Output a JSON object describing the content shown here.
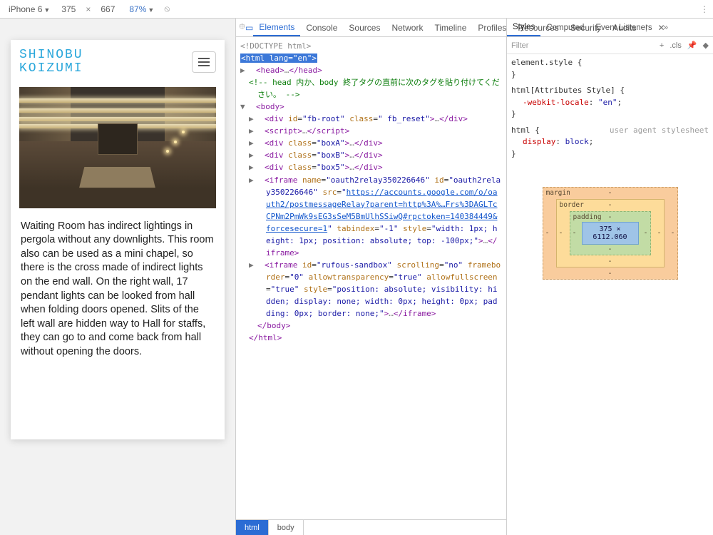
{
  "deviceToolbar": {
    "device": "iPhone 6",
    "width": "375",
    "height": "667",
    "zoom": "87%"
  },
  "mobile": {
    "logoLine1": "SHINOBU",
    "logoLine2": "KOIZUMI",
    "bodyText": "Waiting Room has indirect lightings in pergola without any downlights. This room also can be used as a mini chapel, so there is the cross made of indirect lights on the end wall. On the right wall, 17 pendant lights can be looked from hall when folding doors opened. Slits of the left wall are hidden way to Hall for staffs, they can go to and come back from hall without opening the doors."
  },
  "devtools": {
    "tabs": [
      "Elements",
      "Console",
      "Sources",
      "Network",
      "Timeline",
      "Profiles",
      "Resources",
      "Security",
      "Audits"
    ],
    "activeTab": "Elements"
  },
  "dom": {
    "doctype": "<!DOCTYPE html>",
    "htmlOpen1": "<",
    "htmlTag": "html",
    "langAttr": "lang",
    "langVal": "en",
    "headLine": "<head>…</head>",
    "comment": "<!-- head 内か、body 終了タグの直前に次のタグを貼り付けてください。 -->",
    "bodyOpen": "<body>",
    "fbRoot": "<div id=\"fb-root\" class=\" fb_reset\">…</div>",
    "script": "<script>…</script>",
    "boxA": "<div class=\"boxA\">…</div>",
    "boxB": "<div class=\"boxB\">…</div>",
    "box5": "<div class=\"box5\">…</div>",
    "iframe1a": "<iframe name=\"oauth2relay350226646\" id=\"oauth2relay350226646\" src=\"",
    "iframe1Url": "https://accounts.google.com/o/oauth2/postmessageRelay?parent=http%3A%…Frs%3DAGLTcCPNm2PmWk9sEG3sSeM5BmUlhSSiwQ#rpctoken=140384449&forcesecure=1",
    "iframe1b": "\" tabindex=\"-1\" style=\"width: 1px; height: 1px; position: absolute; top: -100px;\">…</iframe>",
    "iframe2": "<iframe id=\"rufous-sandbox\" scrolling=\"no\" frameborder=\"0\" allowtransparency=\"true\" allowfullscreen=\"true\" style=\"position: absolute; visibility: hidden; display: none; width: 0px; height: 0px; padding: 0px; border: none;\">…</iframe>",
    "bodyClose": "</body>",
    "htmlClose": "</html>"
  },
  "crumbs": {
    "c1": "html",
    "c2": "body"
  },
  "stylesTabs": [
    "Styles",
    "Computed",
    "Event Listeners"
  ],
  "filter": {
    "placeholder": "Filter",
    "cls": ".cls"
  },
  "rules": {
    "r1sel": "element.style",
    "r2sel": "html[Attributes Style]",
    "r2prop": "-webkit-locale",
    "r2val": "\"en\"",
    "r3sel": "html",
    "r3ua": "user agent stylesheet",
    "r3prop": "display",
    "r3val": "block"
  },
  "boxmodel": {
    "margin": "margin",
    "border": "border",
    "padding": "padding",
    "content": "375 × 6112.060",
    "dash": "-"
  }
}
